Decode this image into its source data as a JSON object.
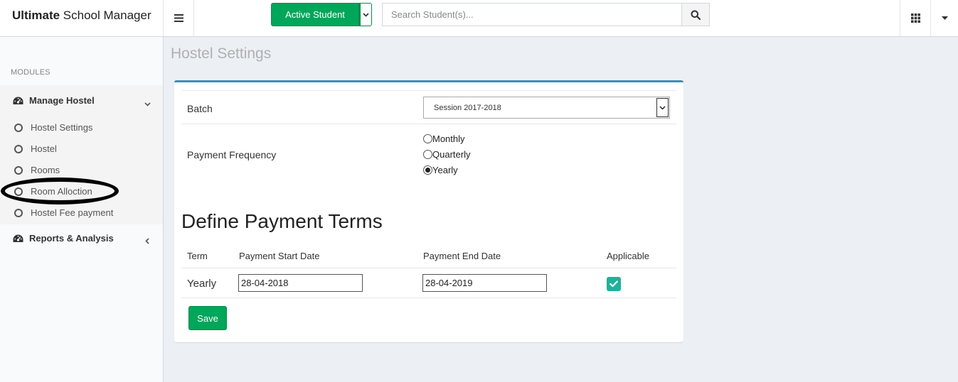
{
  "app": {
    "title_bold": "Ultimate",
    "title_rest": " School Manager"
  },
  "header": {
    "active_student_label": "Active Student",
    "search_placeholder": "Search Student(s)..."
  },
  "sidebar": {
    "modules_header": "MODULES",
    "groups": [
      {
        "label": "Manage Hostel",
        "icon": "dashboard-gauge-icon",
        "expanded": true,
        "items": [
          {
            "label": "Hostel Settings"
          },
          {
            "label": "Hostel"
          },
          {
            "label": "Rooms"
          },
          {
            "label": "Room Alloction"
          },
          {
            "label": "Hostel Fee payment"
          }
        ]
      },
      {
        "label": "Reports & Analysis",
        "icon": "dashboard-gauge-icon",
        "expanded": false
      }
    ]
  },
  "page": {
    "title": "Hostel Settings",
    "batch_label": "Batch",
    "batch_value": "Session 2017-2018",
    "payment_frequency_label": "Payment Frequency",
    "frequency_options": [
      {
        "label": "Monthly",
        "selected": false
      },
      {
        "label": "Quarterly",
        "selected": false
      },
      {
        "label": "Yearly",
        "selected": true
      }
    ],
    "section_title": "Define Payment Terms",
    "table": {
      "columns": [
        "Term",
        "Payment Start Date",
        "Payment End Date",
        "Applicable"
      ],
      "rows": [
        {
          "term": "Yearly",
          "start": "28-04-2018",
          "end": "28-04-2019",
          "applicable": true
        }
      ]
    },
    "save_label": "Save"
  },
  "colors": {
    "accent_green": "#00a65a",
    "box_top_border": "#3c8dbc",
    "checkbox": "#1fb19a"
  }
}
